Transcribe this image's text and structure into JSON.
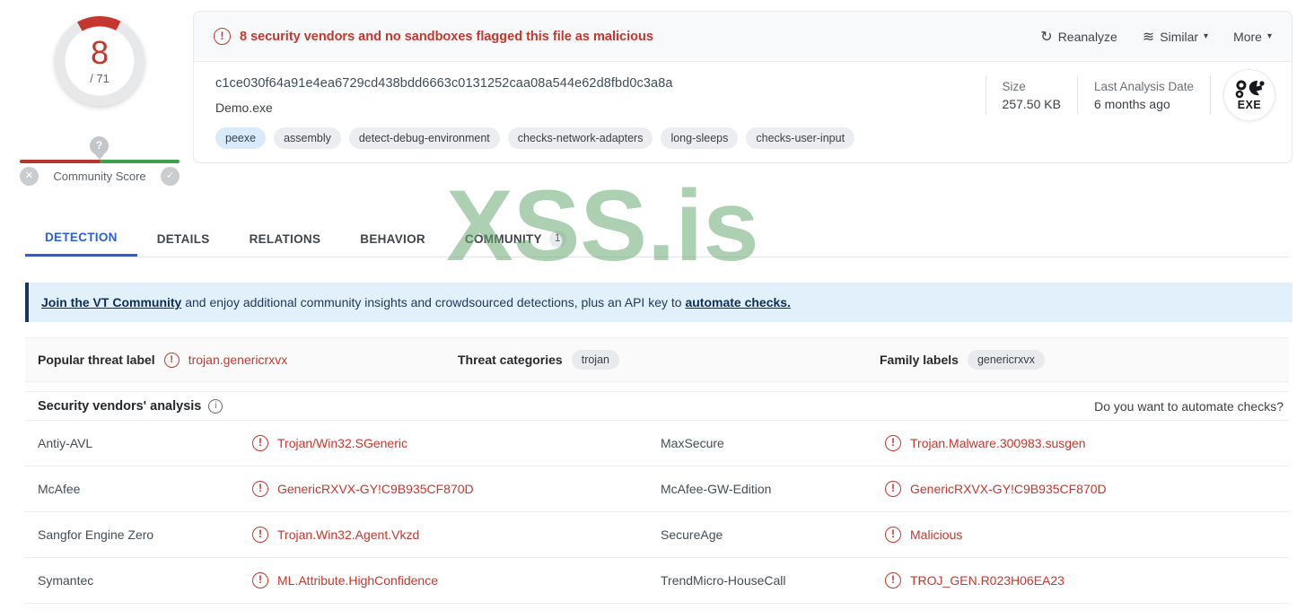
{
  "colors": {
    "accent_red": "#c5372e",
    "accent_blue": "#2b5ed8",
    "score_green": "#3fa049",
    "watermark_green": "#a9d2ae",
    "banner_bg": "#e2f0fb",
    "banner_navy": "#17365d"
  },
  "icons": {
    "alert": "!",
    "info": "i",
    "reanalyze": "↻",
    "similar": "≋",
    "caret": "▾",
    "close": "✕",
    "check": "✓",
    "question": "?"
  },
  "score": {
    "positives": "8",
    "denominator": "/ 71",
    "community_label": "Community Score"
  },
  "header": {
    "alert_text": "8 security vendors and no sandboxes flagged this file as malicious",
    "actions": {
      "reanalyze": "Reanalyze",
      "similar": "Similar",
      "more": "More"
    }
  },
  "file": {
    "hash": "c1ce030f64a91e4ea6729cd438bdd6663c0131252caa08a544e62d8fbd0c3a8a",
    "name": "Demo.exe",
    "tags": [
      "peexe",
      "assembly",
      "detect-debug-environment",
      "checks-network-adapters",
      "long-sleeps",
      "checks-user-input"
    ],
    "size_label": "Size",
    "size_value": "257.50 KB",
    "date_label": "Last Analysis Date",
    "date_value": "6 months ago",
    "type_label": "EXE"
  },
  "tabs": {
    "detection": "DETECTION",
    "details": "DETAILS",
    "relations": "RELATIONS",
    "behavior": "BEHAVIOR",
    "community": "COMMUNITY",
    "community_badge": "1"
  },
  "watermark": "XSS.is",
  "banner": {
    "join_link": "Join the VT Community",
    "middle": " and enjoy additional community insights and crowdsourced detections, plus an API key to ",
    "automate_link": "automate checks."
  },
  "threat": {
    "popular_label": "Popular threat label",
    "popular_value": "trojan.genericrxvx",
    "categories_label": "Threat categories",
    "categories_value": "trojan",
    "family_label": "Family labels",
    "family_value": "genericrxvx"
  },
  "analysis": {
    "title": "Security vendors' analysis",
    "automate_prompt": "Do you want to automate checks?",
    "rows": [
      {
        "v1": "Antiy-AVL",
        "r1": "Trojan/Win32.SGeneric",
        "v2": "MaxSecure",
        "r2": "Trojan.Malware.300983.susgen"
      },
      {
        "v1": "McAfee",
        "r1": "GenericRXVX-GY!C9B935CF870D",
        "v2": "McAfee-GW-Edition",
        "r2": "GenericRXVX-GY!C9B935CF870D"
      },
      {
        "v1": "Sangfor Engine Zero",
        "r1": "Trojan.Win32.Agent.Vkzd",
        "v2": "SecureAge",
        "r2": "Malicious"
      },
      {
        "v1": "Symantec",
        "r1": "ML.Attribute.HighConfidence",
        "v2": "TrendMicro-HouseCall",
        "r2": "TROJ_GEN.R023H06EA23"
      }
    ]
  }
}
